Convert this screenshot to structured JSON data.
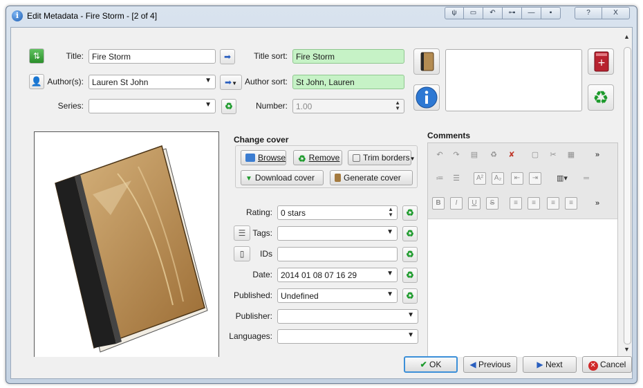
{
  "window": {
    "title": "Edit Metadata - Fire Storm -  [2 of 4]",
    "titlebar_buttons": [
      "pin-icon",
      "restore-icon",
      "undo-icon",
      "connector-icon",
      "minimize-icon",
      "dot-icon"
    ],
    "help_label": "?",
    "close_label": "X"
  },
  "basic": {
    "title_label": "Title:",
    "title_value": "Fire Storm",
    "title_sort_label": "Title sort:",
    "title_sort_value": "Fire Storm",
    "author_label": "Author(s):",
    "author_value": "Lauren St John",
    "author_sort_label": "Author sort:",
    "author_sort_value": "St John, Lauren",
    "series_label": "Series:",
    "series_value": "",
    "number_label": "Number:",
    "number_value": "1.00"
  },
  "cover": {
    "group_title": "Change cover",
    "browse_label": "Browse",
    "remove_label": "Remove",
    "trim_label": "Trim borders",
    "download_label": "Download cover",
    "generate_label": "Generate cover"
  },
  "fields": {
    "rating_label": "Rating:",
    "rating_value": "0 stars",
    "tags_label": "Tags:",
    "tags_value": "",
    "ids_label": "IDs",
    "ids_value": "",
    "date_label": "Date:",
    "date_value": "2014 01 08 07 16 29",
    "published_label": "Published:",
    "published_value": "Undefined",
    "publisher_label": "Publisher:",
    "publisher_value": "",
    "languages_label": "Languages:",
    "languages_value": ""
  },
  "comments": {
    "title": "Comments",
    "more_label": "»"
  },
  "footer": {
    "ok_label": "OK",
    "previous_label": "Previous",
    "next_label": "Next",
    "cancel_label": "Cancel"
  },
  "colors": {
    "sort_field_bg": "#c6f2c6",
    "window_frame": "#c5d3e3",
    "recycle_green": "#1d9a2c"
  }
}
